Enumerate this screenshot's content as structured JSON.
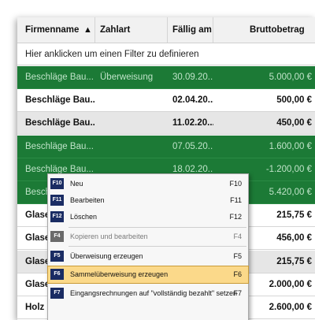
{
  "header": {
    "col_company": "Firmenname",
    "sort_icon": "▲",
    "col_payment": "Zahlart",
    "col_due": "Fällig am",
    "col_gross": "Bruttobetrag"
  },
  "filter_text": "Hier anklicken um einen Filter zu definieren",
  "rows": [
    {
      "company": "Beschläge Bau...",
      "payment": "Überweisung",
      "due": "30.09.20...",
      "gross": "5.000,00 €",
      "style": "green"
    },
    {
      "company": "Beschläge Bau...",
      "payment": "",
      "due": "02.04.20...",
      "gross": "500,00 €",
      "style": "white"
    },
    {
      "company": "Beschläge Bau...",
      "payment": "",
      "due": "11.02.20...",
      "gross": "450,00 €",
      "style": "grey"
    },
    {
      "company": "Beschläge Bau...",
      "payment": "",
      "due": "07.05.20...",
      "gross": "1.600,00 €",
      "style": "green"
    },
    {
      "company": "Beschläge Bau...",
      "payment": "",
      "due": "18.02.20...",
      "gross": "-1.200,00 €",
      "style": "green"
    },
    {
      "company": "Besch",
      "payment": "",
      "due": "",
      "gross": "5.420,00 €",
      "style": "green"
    },
    {
      "company": "Glaser",
      "payment": "",
      "due": "",
      "gross": "215,75 €",
      "style": "white"
    },
    {
      "company": "Glaser",
      "payment": "",
      "due": "",
      "gross": "456,00 €",
      "style": "white"
    },
    {
      "company": "Glaser",
      "payment": "",
      "due": "",
      "gross": "215,75 €",
      "style": "grey"
    },
    {
      "company": "Glaser",
      "payment": "",
      "due": "",
      "gross": "2.000,00 €",
      "style": "white"
    },
    {
      "company": "Holz",
      "payment": "",
      "due": "",
      "gross": "2.600,00 €",
      "style": "white"
    }
  ],
  "context_menu": [
    {
      "key": "F10",
      "label": "Neu",
      "shortcut": "F10",
      "state": "normal"
    },
    {
      "key": "F11",
      "label": "Bearbeiten",
      "shortcut": "F11",
      "state": "normal"
    },
    {
      "key": "F12",
      "label": "Löschen",
      "shortcut": "F12",
      "state": "normal"
    },
    {
      "key": "F4",
      "label": "Kopieren und bearbeiten",
      "shortcut": "F4",
      "state": "disabled"
    },
    {
      "key": "F5",
      "label": "Überweisung erzeugen",
      "shortcut": "F5",
      "state": "normal"
    },
    {
      "key": "F6",
      "label": "Sammelüberweisung erzeugen",
      "shortcut": "F6",
      "state": "selected"
    },
    {
      "key": "F7",
      "label": "Eingangsrechnungen auf \"vollständig bezahlt\" setzen",
      "shortcut": "F7",
      "state": "normal"
    }
  ]
}
